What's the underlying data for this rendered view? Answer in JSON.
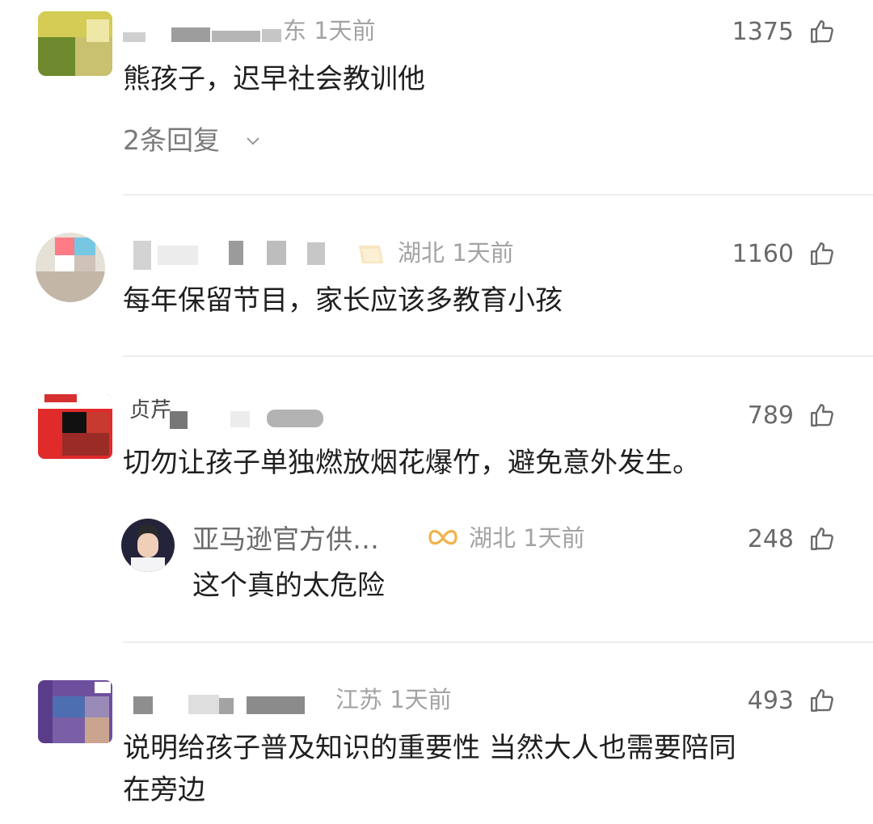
{
  "comments": [
    {
      "meta": "东 1天前",
      "likes": "1375",
      "content": "熊孩子，迟早社会教训他",
      "replies_label": "2条回复"
    },
    {
      "meta": "湖北 1天前",
      "likes": "1160",
      "content": "每年保留节目，家长应该多教育小孩"
    },
    {
      "likes": "789",
      "content": "切勿让孩子单独燃放烟花爆竹，避免意外发生。",
      "reply": {
        "username": "亚马逊官方供…",
        "meta": "湖北 1天前",
        "likes": "248",
        "content": "这个真的太危险"
      }
    },
    {
      "meta": "江苏 1天前",
      "likes": "493",
      "content_line1": "说明给孩子普及知识的重要性 当然大人也需要陪同",
      "content_line2": "在旁边"
    }
  ],
  "icons": {
    "like": "thumbs-up-icon",
    "chevron": "chevron-down-icon",
    "badge": "vip-badge-icon"
  },
  "colors": {
    "text": "#1f1f1f",
    "meta": "#a3a3a3",
    "likes": "#6a6a6a",
    "divider": "#ededed",
    "badge": "#f0b24a"
  }
}
